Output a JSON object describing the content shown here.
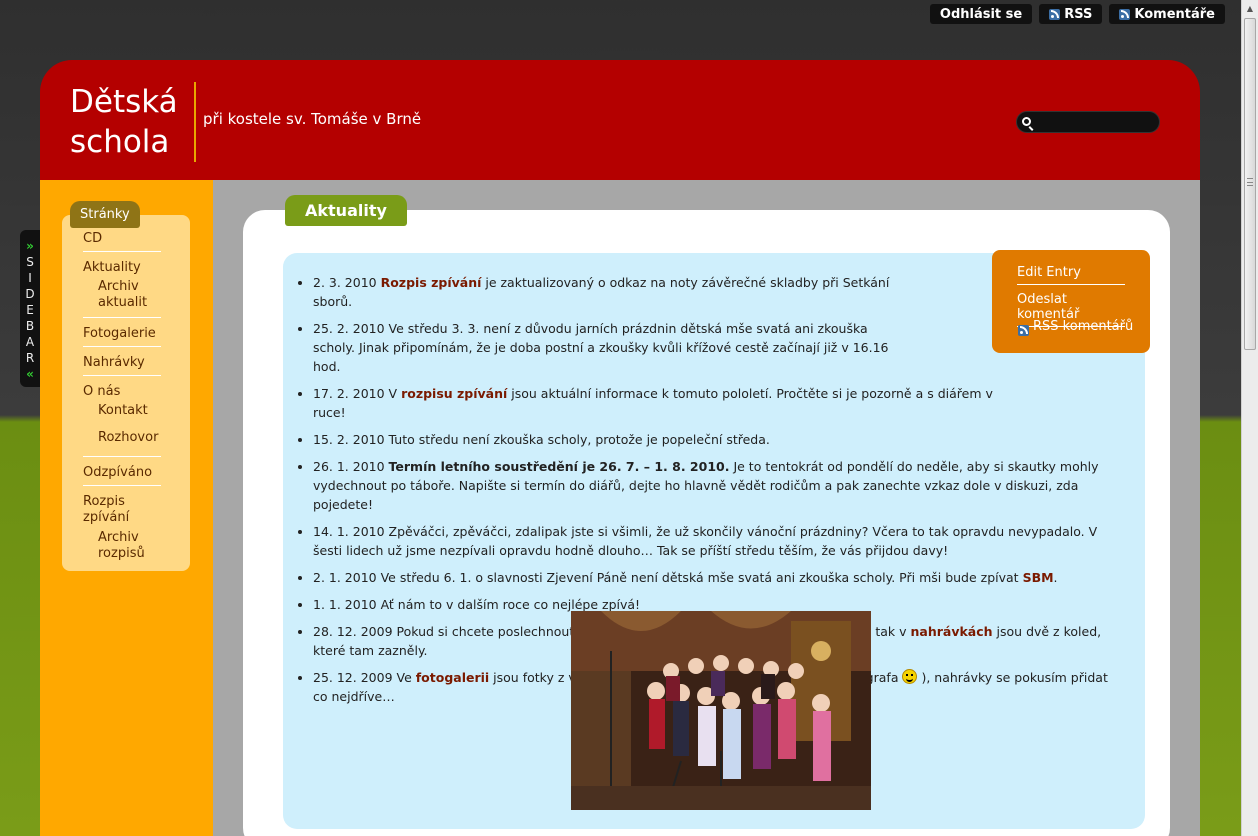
{
  "topbar": {
    "logout_label": "Odhlásit se",
    "rss_label": "RSS",
    "comments_label": "Komentáře"
  },
  "sidebar_tab": {
    "open_arrow": "»",
    "letters": [
      "S",
      "I",
      "D",
      "E",
      "B",
      "A",
      "R"
    ],
    "close_arrow": "«"
  },
  "header": {
    "title_line1": "Dětská",
    "title_line2": "schola",
    "subtitle": "při kostele sv. Tomáše v Brně",
    "search_placeholder": ""
  },
  "nav": {
    "heading": "Stránky",
    "items": [
      {
        "label": "CD"
      },
      {
        "label": "Aktuality",
        "children": [
          "Archiv aktualit"
        ]
      },
      {
        "label": "Fotogalerie"
      },
      {
        "label": "Nahrávky"
      },
      {
        "label": "O nás",
        "children": [
          "Kontakt",
          "Rozhovor"
        ]
      },
      {
        "label": "Odzpíváno"
      },
      {
        "label": "Rozpis zpívání",
        "children": [
          "Archiv rozpisů"
        ]
      }
    ]
  },
  "main": {
    "title": "Aktuality"
  },
  "editbox": {
    "edit_entry": "Edit Entry",
    "send_comment": "Odeslat komentář",
    "rss_comments": "RSS komentářů"
  },
  "news": [
    {
      "pre": "2. 3. 2010 ",
      "link": "Rozpis zpívání",
      "post": " je zaktualizovaný o odkaz na noty závěrečné skladby při Setkání sborů."
    },
    {
      "pre": "25. 2. 2010 Ve středu 3. 3. není z důvodu jarních prázdnin dětská mše svatá ani zkouška scholy. Jinak připomínám, že je doba postní a zkoušky kvůli křížové cestě začínají již v 16.16 hod.",
      "link": "",
      "post": ""
    },
    {
      "pre": "17. 2. 2010 V ",
      "link": "rozpisu zpívání",
      "post": " jsou aktuální informace k tomuto pololetí. Pročtěte si je pozorně a s diářem v ruce!"
    },
    {
      "pre": "15. 2. 2010 Tuto středu není zkouška scholy, protože je popeleční středa.",
      "link": "",
      "post": ""
    },
    {
      "pre": "26. 1. 2010 ",
      "bold": "Termín letního soustředění je 26. 7. – 1. 8. 2010.",
      "post": " Je to tentokrát od pondělí do neděle, aby si skautky mohly vydechnout po táboře. Napište si termín do diářů, dejte ho hlavně vědět rodičům a pak zanechte vzkaz dole v diskuzi, zda pojedete!"
    },
    {
      "pre": "14. 1. 2010 Zpěváčci, zpěváčci, zdalipak jste si všimli, že už skončily vánoční prázdniny? Včera to tak opravdu nevypadalo. V šesti lidech už jsme nezpívali opravdu hodně dlouho… Tak se příští středu těším, že vás přijdou davy!",
      "link": "",
      "post": ""
    },
    {
      "pre": "2. 1. 2010 Ve středu 6. 1. o slavnosti Zjevení Páně není dětská mše svatá ani zkouška scholy. Při mši bude zpívat ",
      "link": "SBM",
      "post": "."
    },
    {
      "pre": "1. 1. 2010 Ať nám to v dalším roce co nejlépe zpívá!",
      "link": "",
      "post": ""
    },
    {
      "pre": "28. 12. 2009 Pokud si chcete poslechnout, jak jsme zpívali na vánoční mši svaté pro děti, tak v ",
      "link": "nahrávkách",
      "post": " jsou dvě z koled, které tam zazněly."
    },
    {
      "pre": "25. 12. 2009 Ve ",
      "link": "fotogalerii",
      "post": " jsou fotky z vánočního zpívání (nezapomeňte pochválit fotografa ",
      "post2": " ), nahrávky se pokusím přidat co nejdříve…"
    }
  ]
}
